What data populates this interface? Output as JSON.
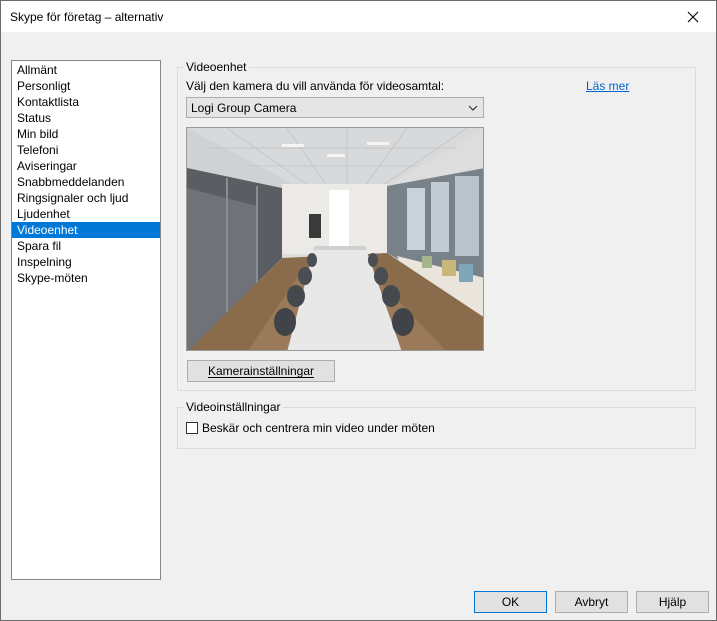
{
  "window": {
    "title": "Skype för företag – alternativ"
  },
  "nav": {
    "items": [
      {
        "label": "Allmänt"
      },
      {
        "label": "Personligt"
      },
      {
        "label": "Kontaktlista"
      },
      {
        "label": "Status"
      },
      {
        "label": "Min bild"
      },
      {
        "label": "Telefoni"
      },
      {
        "label": "Aviseringar"
      },
      {
        "label": "Snabbmeddelanden"
      },
      {
        "label": "Ringsignaler och ljud"
      },
      {
        "label": "Ljudenhet"
      },
      {
        "label": "Videoenhet",
        "selected": true
      },
      {
        "label": "Spara fil"
      },
      {
        "label": "Inspelning"
      },
      {
        "label": "Skype-möten"
      }
    ]
  },
  "video_device": {
    "group_title": "Videoenhet",
    "camera_prompt": "Välj den kamera du vill använda för videosamtal:",
    "learn_more": "Läs mer",
    "selected_camera": "Logi Group Camera",
    "camera_settings_button": "Kamerainställningar"
  },
  "video_settings": {
    "group_title": "Videoinställningar",
    "crop_center_label": "Beskär och centrera min video under möten",
    "crop_center_checked": false
  },
  "footer": {
    "ok": "OK",
    "cancel": "Avbryt",
    "help": "Hjälp"
  },
  "colors": {
    "selection": "#0078d7",
    "link": "#0066cc"
  }
}
